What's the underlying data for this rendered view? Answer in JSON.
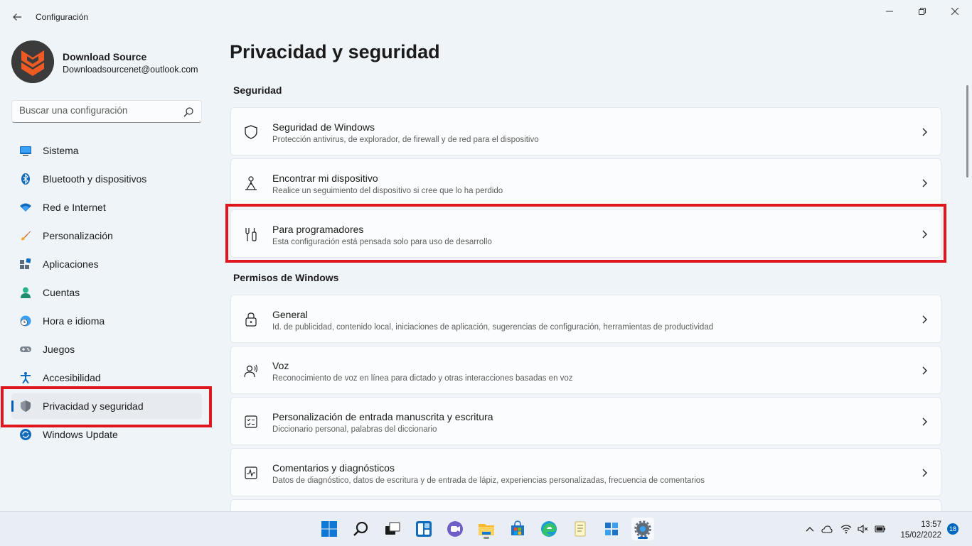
{
  "window": {
    "title": "Configuración"
  },
  "profile": {
    "name": "Download Source",
    "email": "Downloadsourcenet@outlook.com"
  },
  "search": {
    "placeholder": "Buscar una configuración"
  },
  "nav": {
    "items": [
      {
        "label": "Sistema",
        "icon": "monitor-icon"
      },
      {
        "label": "Bluetooth y dispositivos",
        "icon": "bluetooth-icon"
      },
      {
        "label": "Red e Internet",
        "icon": "wifi-icon"
      },
      {
        "label": "Personalización",
        "icon": "brush-icon"
      },
      {
        "label": "Aplicaciones",
        "icon": "apps-icon"
      },
      {
        "label": "Cuentas",
        "icon": "person-icon"
      },
      {
        "label": "Hora e idioma",
        "icon": "clock-globe-icon"
      },
      {
        "label": "Juegos",
        "icon": "gamepad-icon"
      },
      {
        "label": "Accesibilidad",
        "icon": "accessibility-icon"
      },
      {
        "label": "Privacidad y seguridad",
        "icon": "shield-icon"
      },
      {
        "label": "Windows Update",
        "icon": "update-icon"
      }
    ],
    "active_index": 9
  },
  "main": {
    "title": "Privacidad y seguridad",
    "sections": [
      {
        "title": "Seguridad",
        "cards": [
          {
            "title": "Seguridad de Windows",
            "subtitle": "Protección antivirus, de explorador, de firewall y de red para el dispositivo",
            "icon": "shield-outline-icon"
          },
          {
            "title": "Encontrar mi dispositivo",
            "subtitle": "Realice un seguimiento del dispositivo si cree que lo ha perdido",
            "icon": "location-person-icon"
          },
          {
            "title": "Para programadores",
            "subtitle": "Esta configuración está pensada solo para uso de desarrollo",
            "icon": "developer-tools-icon"
          }
        ]
      },
      {
        "title": "Permisos de Windows",
        "cards": [
          {
            "title": "General",
            "subtitle": "Id. de publicidad, contenido local, iniciaciones de aplicación, sugerencias de configuración, herramientas de productividad",
            "icon": "lock-icon"
          },
          {
            "title": "Voz",
            "subtitle": "Reconocimiento de voz en línea para dictado y otras interacciones basadas en voz",
            "icon": "speech-icon"
          },
          {
            "title": "Personalización de entrada manuscrita y escritura",
            "subtitle": "Diccionario personal, palabras del diccionario",
            "icon": "checklist-icon"
          },
          {
            "title": "Comentarios y diagnósticos",
            "subtitle": "Datos de diagnóstico, datos de escritura y de entrada de lápiz, experiencias personalizadas, frecuencia de comentarios",
            "icon": "pulse-icon"
          }
        ]
      }
    ]
  },
  "taskbar": {
    "apps": [
      "start-icon",
      "search-icon",
      "task-view-icon",
      "widgets-icon",
      "teams-chat-icon",
      "file-explorer-icon",
      "store-icon",
      "edge-icon",
      "notepad-icon",
      "app-icon",
      "settings-icon"
    ],
    "active_app": "settings-icon",
    "time": "13:57",
    "date": "15/02/2022",
    "notifications": "18"
  },
  "colors": {
    "accent": "#005fb8",
    "highlight": "#e0161f"
  }
}
